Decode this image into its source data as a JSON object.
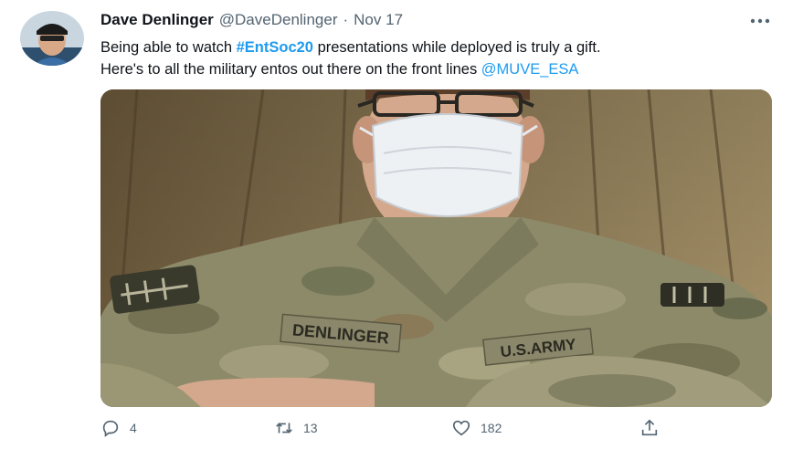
{
  "tweet": {
    "display_name": "Dave Denlinger",
    "handle": "@DaveDenlinger",
    "separator": "·",
    "time": "Nov 17",
    "text": {
      "line1_before": "Being able to watch ",
      "hashtag": "#EntSoc20",
      "line1_after": " presentations while deployed is truly a gift.",
      "line2_before": "Here's to all the military entos out there on the front lines ",
      "mention": "@MUVE_ESA"
    },
    "media": {
      "name_tape": "DENLINGER",
      "branch_tape": "U.S.ARMY"
    }
  },
  "actions": {
    "reply_count": "4",
    "retweet_count": "13",
    "like_count": "182"
  },
  "icons": {
    "more": "more-icon",
    "reply": "reply-icon",
    "retweet": "retweet-icon",
    "like": "heart-icon",
    "share": "share-icon"
  },
  "colors": {
    "link": "#1d9bf0",
    "text": "#0f1419",
    "secondary": "#536471"
  }
}
